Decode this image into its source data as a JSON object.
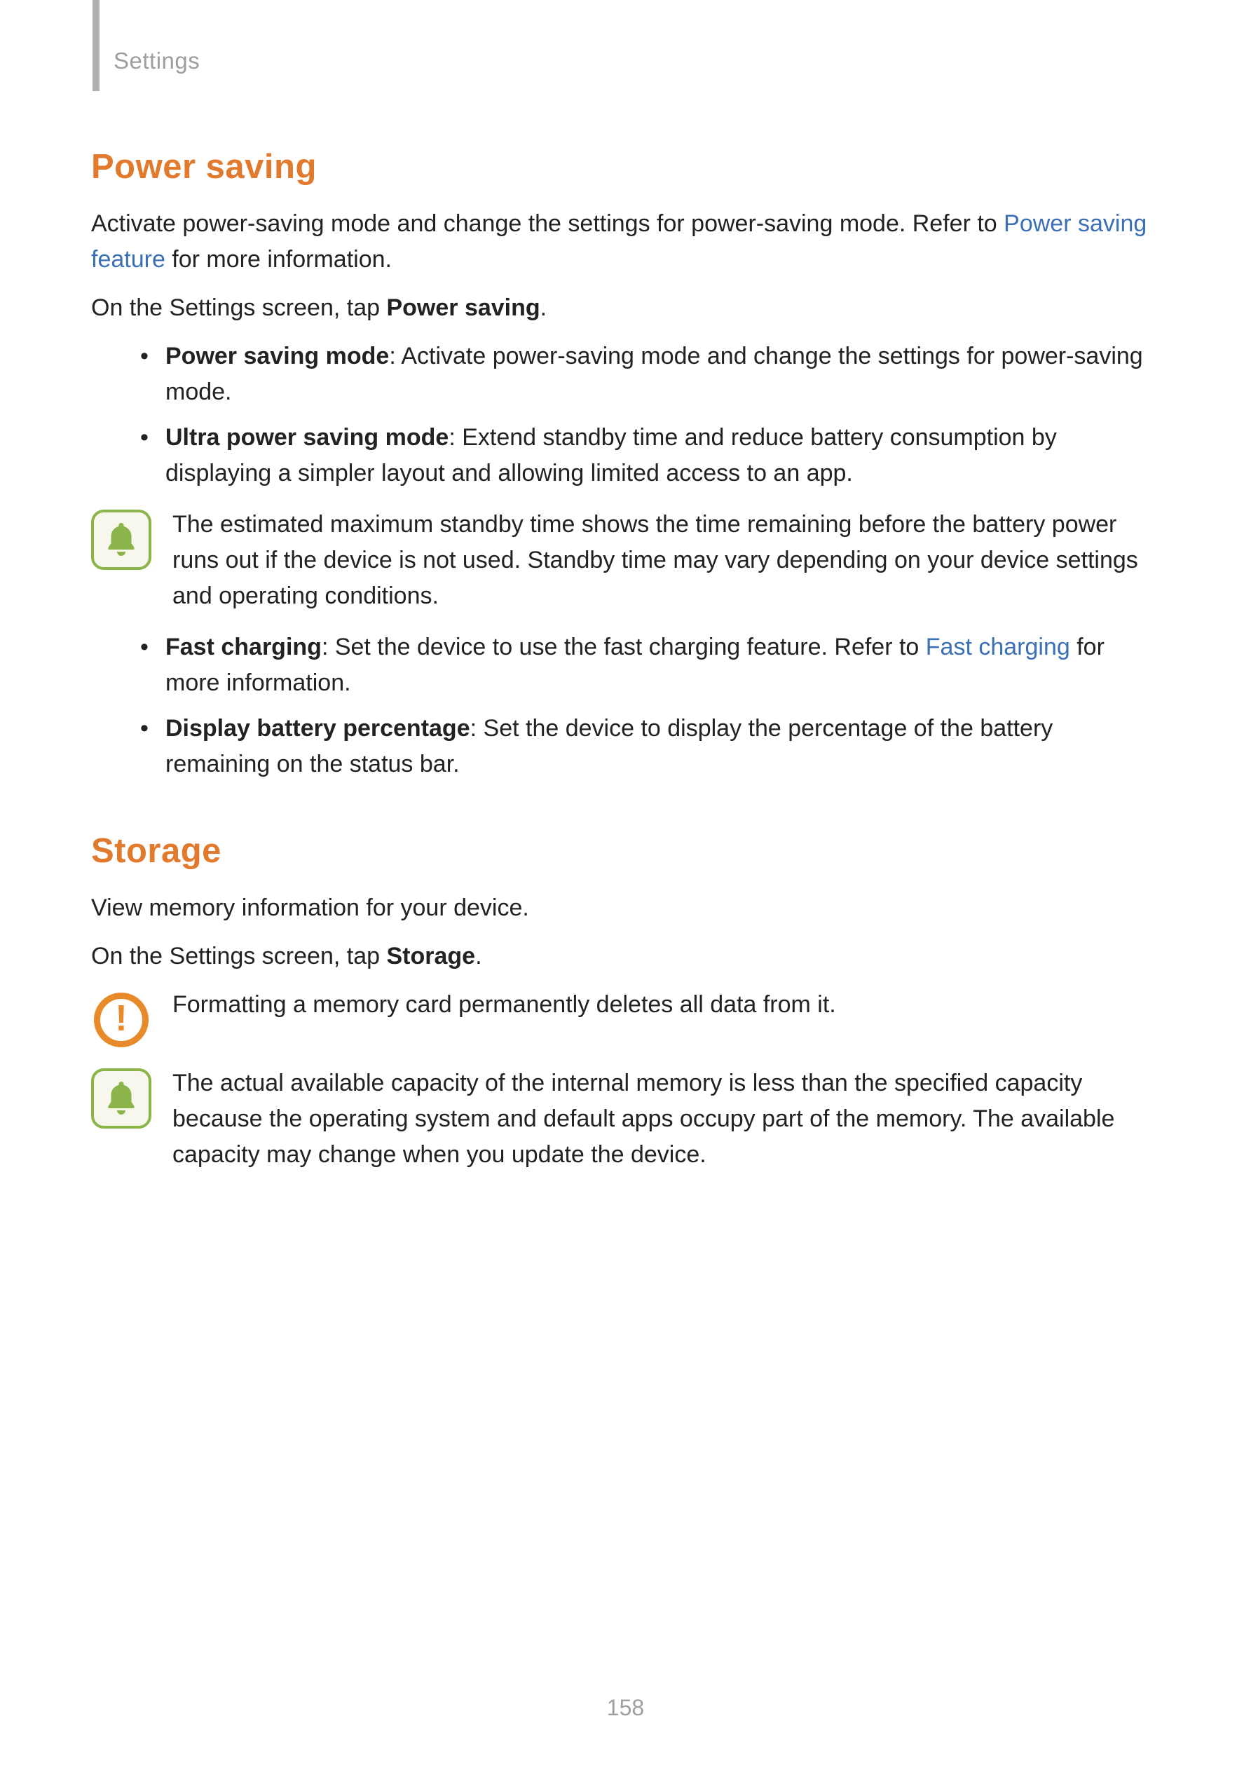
{
  "breadcrumb": "Settings",
  "page_number": "158",
  "sections": {
    "power_saving": {
      "heading": "Power saving",
      "intro_a": "Activate power-saving mode and change the settings for power-saving mode. Refer to ",
      "intro_link": "Power saving feature",
      "intro_b": " for more information.",
      "nav_a": "On the Settings screen, tap ",
      "nav_b": "Power saving",
      "nav_c": ".",
      "bullets": {
        "b1_label": "Power saving mode",
        "b1_text": ": Activate power-saving mode and change the settings for power-saving mode.",
        "b2_label": "Ultra power saving mode",
        "b2_text": ": Extend standby time and reduce battery consumption by displaying a simpler layout and allowing limited access to an app."
      },
      "note1": "The estimated maximum standby time shows the time remaining before the battery power runs out if the device is not used. Standby time may vary depending on your device settings and operating conditions.",
      "bullets2": {
        "b3_label": "Fast charging",
        "b3_text_a": ": Set the device to use the fast charging feature. Refer to ",
        "b3_link": "Fast charging",
        "b3_text_b": " for more information.",
        "b4_label": "Display battery percentage",
        "b4_text": ": Set the device to display the percentage of the battery remaining on the status bar."
      }
    },
    "storage": {
      "heading": "Storage",
      "intro": "View memory information for your device.",
      "nav_a": "On the Settings screen, tap ",
      "nav_b": "Storage",
      "nav_c": ".",
      "warn": "Formatting a memory card permanently deletes all data from it.",
      "note": "The actual available capacity of the internal memory is less than the specified capacity because the operating system and default apps occupy part of the memory. The available capacity may change when you update the device."
    }
  }
}
